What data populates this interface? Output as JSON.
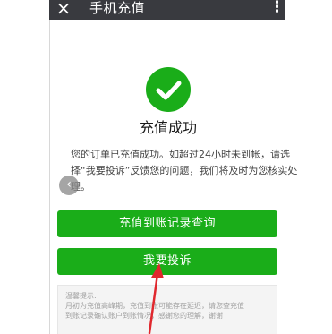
{
  "header": {
    "close_icon": "×",
    "title": "手机充值",
    "more_icon": "⋮"
  },
  "status": {
    "icon": "check-circle",
    "title": "充值成功",
    "desc_line1": "您的订单已充值成功。如超过24小时未到帐，请选",
    "desc_line2": "择“我要投诉”反馈您的问题，我们将及时为您核实处",
    "desc_line3": "理。"
  },
  "back_bubble": "‹",
  "buttons": {
    "records_label": "充值到账记录查询",
    "complain_label": "我要投诉"
  },
  "tips": {
    "title": "温馨提示:",
    "line1": "月初为充值高峰期，充值到账可能存在延迟，请您查充值",
    "line2": "到账记录确认账户到账情况，感谢您的理解，谢谢"
  },
  "colors": {
    "accent": "#1aad19",
    "header_bg": "#393a3f",
    "arrow": "#e0282e"
  }
}
